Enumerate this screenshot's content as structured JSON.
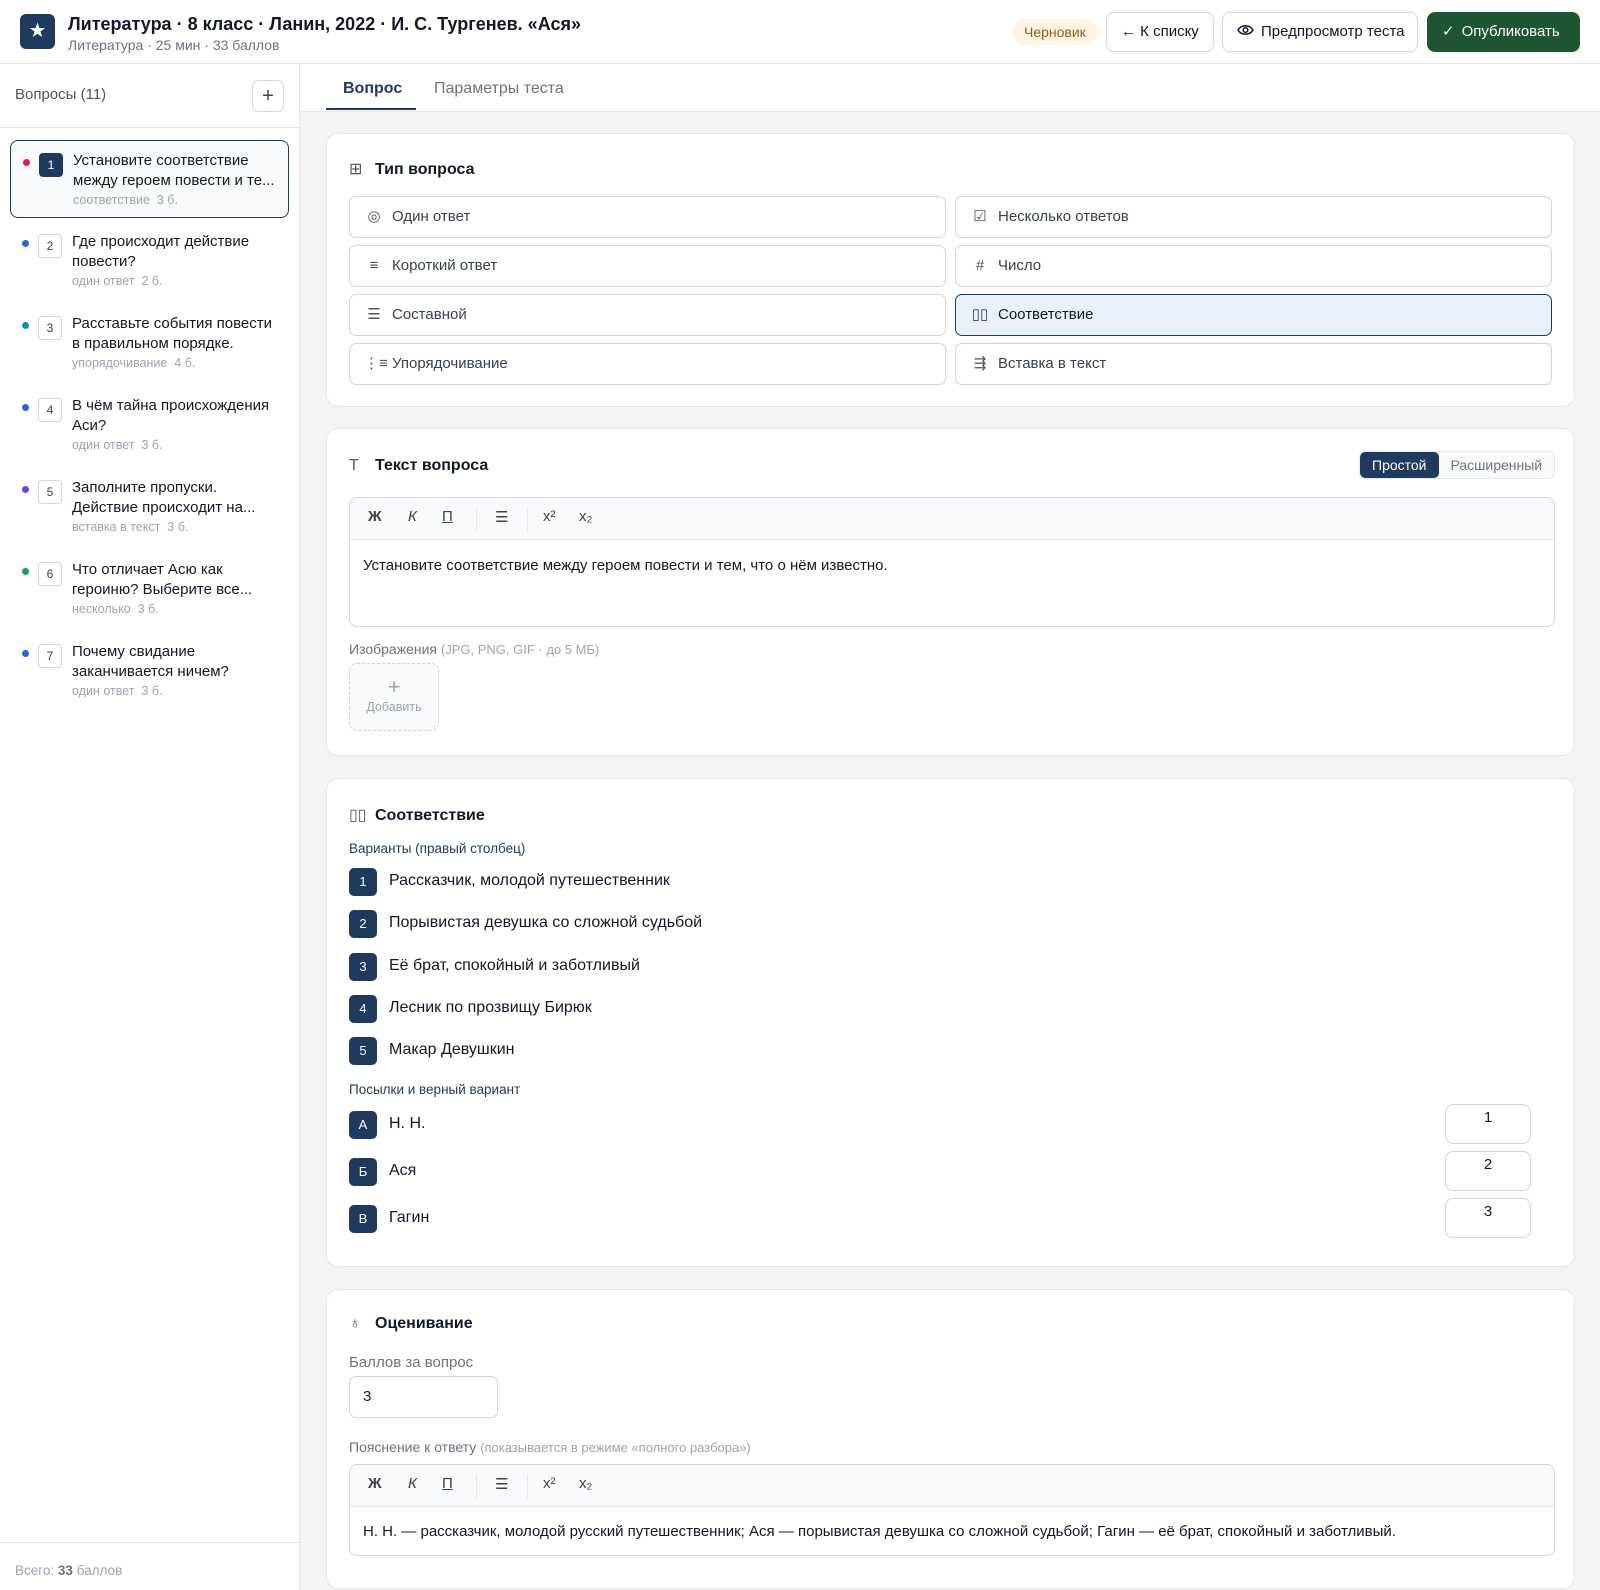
{
  "header": {
    "logo_glyph": "★",
    "title": "Литература · 8 класс · Ланин, 2022 · И. С. Тургенев. «Ася»",
    "subtitle": "Литература · 25 мин · 33 баллов",
    "status_badge": "Черновик",
    "back_label": "← К списку",
    "preview_label": "Предпросмотр теста",
    "publish_label": "Опубликовать",
    "status_color": "#9a5b13",
    "publish_color": "#1e5631"
  },
  "sidebar": {
    "heading": "Вопросы (11)",
    "add_glyph": "+",
    "items": [
      {
        "num": "1",
        "text": "Установите соответствие между героем повести и те...",
        "type": "соответствие",
        "points": "3 б.",
        "dot_color": "#e11d48"
      },
      {
        "num": "2",
        "text": "Где происходит действие повести?",
        "type": "один ответ",
        "points": "2 б.",
        "dot_color": "#2563eb"
      },
      {
        "num": "3",
        "text": "Расставьте события повести в правильном порядке.",
        "type": "упорядочивание",
        "points": "4 б.",
        "dot_color": "#0891b2"
      },
      {
        "num": "4",
        "text": "В чём тайна происхождения Аси?",
        "type": "один ответ",
        "points": "3 б.",
        "dot_color": "#2563eb"
      },
      {
        "num": "5",
        "text": "Заполните пропуски. Действие происходит на...",
        "type": "вставка в текст",
        "points": "3 б.",
        "dot_color": "#7c3aed"
      },
      {
        "num": "6",
        "text": "Что отличает Асю как героиню? Выберите все...",
        "type": "несколько",
        "points": "3 б.",
        "dot_color": "#16a34a"
      },
      {
        "num": "7",
        "text": "Почему свидание заканчивается ничем?",
        "type": "один ответ",
        "points": "3 б.",
        "dot_color": "#2563eb"
      }
    ],
    "total_prefix": "Всего:",
    "total_value": "33",
    "total_suffix": "баллов"
  },
  "tabs": {
    "question": "Вопрос",
    "params": "Параметры теста"
  },
  "type_card": {
    "title": "Тип вопроса",
    "options": [
      {
        "label": "Один ответ",
        "icon": "radio-icon",
        "glyph": "◎",
        "selected": false
      },
      {
        "label": "Несколько ответов",
        "icon": "checkbox-icon",
        "glyph": "☑",
        "selected": false
      },
      {
        "label": "Короткий ответ",
        "icon": "short-text-icon",
        "glyph": "≡",
        "selected": false
      },
      {
        "label": "Число",
        "icon": "hash-icon",
        "glyph": "#",
        "selected": false
      },
      {
        "label": "Составной",
        "icon": "list-icon",
        "glyph": "☰",
        "selected": false
      },
      {
        "label": "Соответствие",
        "icon": "columns-icon",
        "glyph": "▯▯",
        "selected": true
      },
      {
        "label": "Упорядочивание",
        "icon": "ordered-list-icon",
        "glyph": "⋮≡",
        "selected": false
      },
      {
        "label": "Вставка в текст",
        "icon": "insert-text-icon",
        "glyph": "⇶",
        "selected": false
      }
    ]
  },
  "question_card": {
    "title": "Текст вопроса",
    "mode_simple": "Простой",
    "mode_advanced": "Расширенный",
    "toolbar": {
      "bold": "Ж",
      "italic": "К",
      "underline": "П",
      "list": "☰",
      "sup": "x²",
      "sub": "x₂"
    },
    "text": "Установите соответствие между героем повести и тем, что о нём известно.",
    "images_label": "Изображения",
    "images_hint": "(JPG, PNG, GIF · до 5 МБ)",
    "add_image": "Добавить",
    "add_glyph": "+"
  },
  "matching_card": {
    "title": "Соответствие",
    "variants_label": "Варианты (правый столбец)",
    "variants": [
      {
        "num": "1",
        "text": "Рассказчик, молодой путешественник"
      },
      {
        "num": "2",
        "text": "Порывистая девушка со сложной судьбой"
      },
      {
        "num": "3",
        "text": "Её брат, спокойный и заботливый"
      },
      {
        "num": "4",
        "text": "Лесник по прозвищу Бирюк"
      },
      {
        "num": "5",
        "text": "Макар Девушкин"
      }
    ],
    "premises_label": "Посылки и верный вариант",
    "premises": [
      {
        "letter": "А",
        "text": "Н. Н.",
        "answer": "1"
      },
      {
        "letter": "Б",
        "text": "Ася",
        "answer": "2"
      },
      {
        "letter": "В",
        "text": "Гагин",
        "answer": "3"
      }
    ]
  },
  "grading_card": {
    "title": "Оценивание",
    "points_label": "Баллов за вопрос",
    "points_value": "3",
    "explanation_label": "Пояснение к ответу",
    "explanation_hint": "(показывается в режиме «полного разбора»)",
    "explanation_text": "Н. Н. — рассказчик, молодой русский путешественник; Ася — порывистая девушка со сложной судьбой; Гагин — её брат, спокойный и заботливый."
  },
  "colors": {
    "accent": "#1e3a5f",
    "selected_bg": "#eaf1fb"
  }
}
